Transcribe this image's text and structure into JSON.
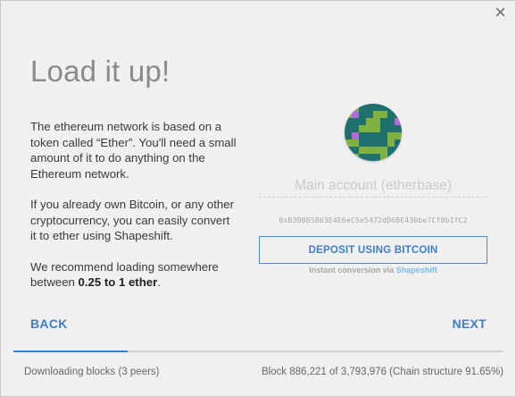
{
  "window": {
    "close_label": "×"
  },
  "page": {
    "title": "Load it up!",
    "paragraphs": [
      "The ethereum network is based on a token called “Ether”. You'll need a small amount of it to do anything on the Ethereum network.",
      "If you already own Bitcoin, or any other cryptocurrency, you can easily convert it to ether using Shapeshift."
    ],
    "recommend_prefix": "We recommend loading somewhere between ",
    "recommend_amount": "0.25 to 1 ether",
    "recommend_suffix": "."
  },
  "account": {
    "placeholder": "Main account (etherbase)",
    "address": "0xB39085863E4E6eC5e5472dD6BE430be7Cf8b1fC2",
    "identicon_colors": {
      "green": "#7fb241",
      "teal": "#1f6f6f",
      "purple": "#b26ad6"
    }
  },
  "deposit": {
    "button_label": "DEPOSIT USING BITCOIN",
    "note_prefix": "Instant conversion via ",
    "note_link": "Shapeshift"
  },
  "nav": {
    "back_label": "BACK",
    "next_label": "NEXT"
  },
  "sync": {
    "progress_fraction": 0.2337,
    "left_text": "Downloading blocks (3 peers)",
    "right_text": "Block 886,221 of 3,793,976 (Chain structure 91.65%)"
  },
  "colors": {
    "accent": "#3e7fc6",
    "background": "#f0f0f0",
    "progress_track": "#d2d2d2"
  }
}
